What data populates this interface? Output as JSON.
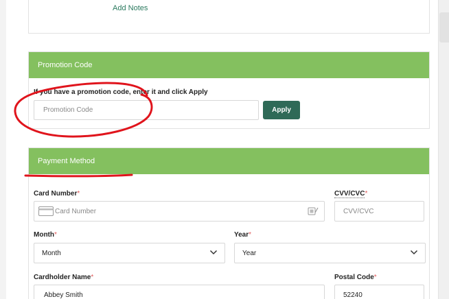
{
  "notes": {
    "add_label": "Add Notes"
  },
  "promo": {
    "title": "Promotion Code",
    "instruction": "If you have a promotion code, enter it and click Apply",
    "placeholder": "Promotion Code",
    "apply_label": "Apply"
  },
  "payment": {
    "title": "Payment Method",
    "card_number": {
      "label": "Card Number",
      "placeholder": "Card Number"
    },
    "cvv": {
      "label": "CVV/CVC",
      "placeholder": "CVV/CVC"
    },
    "month": {
      "label": "Month",
      "value": "Month"
    },
    "year": {
      "label": "Year",
      "value": "Year"
    },
    "cardholder": {
      "label": "Cardholder Name",
      "value": "Abbey Smith"
    },
    "postal": {
      "label": "Postal Code",
      "value": "52240"
    },
    "required_mark": "*"
  },
  "colors": {
    "header_green": "#84c05f",
    "apply_button": "#2f6a57",
    "annotation_red": "#e0141c"
  },
  "icons": [
    "credit-card-icon",
    "card-scan-icon",
    "chevron-down-icon"
  ]
}
